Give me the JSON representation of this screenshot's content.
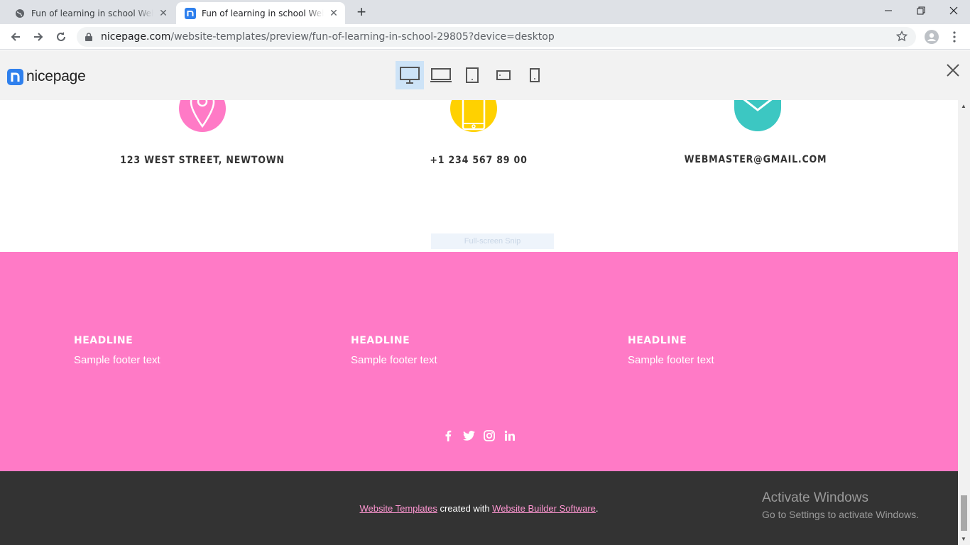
{
  "browser": {
    "tabs": [
      {
        "title": "Fun of learning in school Website Template",
        "active": false
      },
      {
        "title": "Fun of learning in school Website Template",
        "active": true
      }
    ],
    "url_host": "nicepage.com",
    "url_path": "/website-templates/preview/fun-of-learning-in-school-29805?device=desktop"
  },
  "nicepage": {
    "logo_text": "nicepage",
    "devices": [
      "desktop",
      "laptop",
      "tablet",
      "tablet-landscape",
      "phone"
    ],
    "selected_device": "desktop",
    "brand_color": "#2f80ed"
  },
  "contact": {
    "address": "123 WEST STREET, NEWTOWN",
    "phone": "+1 234 567 89 00",
    "email": "WEBMASTER@GMAIL.COM",
    "icon_colors": [
      "#ff7ac6",
      "#ffd100",
      "#3cc7c2"
    ]
  },
  "snip_label": "Full-screen Snip",
  "footer": {
    "bg_color": "#ff7ac6",
    "columns": [
      {
        "headline": "HEADLINE",
        "text": "Sample footer text"
      },
      {
        "headline": "HEADLINE",
        "text": "Sample footer text"
      },
      {
        "headline": "HEADLINE",
        "text": "Sample footer text"
      }
    ],
    "social": [
      "facebook-icon",
      "twitter-icon",
      "instagram-icon",
      "linkedin-icon"
    ]
  },
  "credits": {
    "link1": "Website Templates",
    "middle": " created with ",
    "link2": "Website Builder Software",
    "end": "."
  },
  "watermark": {
    "line1": "Activate Windows",
    "line2": "Go to Settings to activate Windows."
  }
}
